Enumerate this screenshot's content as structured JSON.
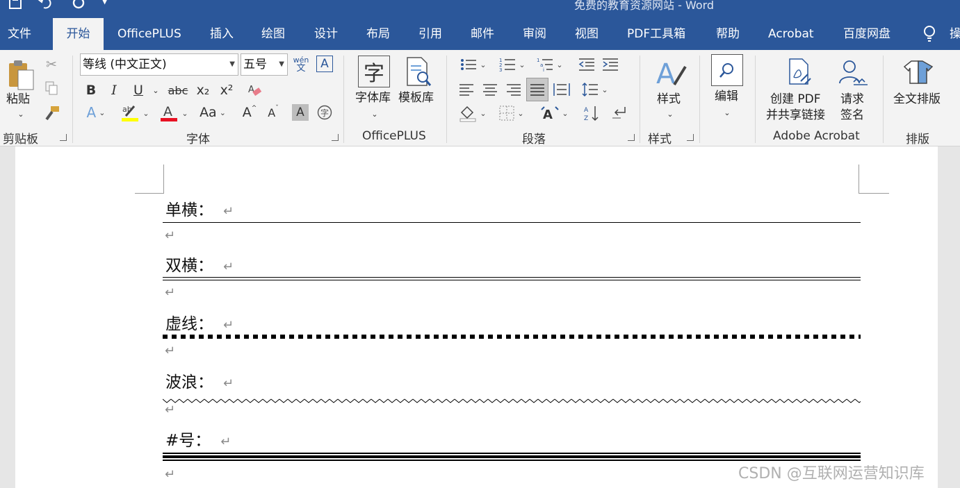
{
  "titlebar": {
    "doc_title": "免费的教育资源网站  -  Word",
    "qat": {
      "save_icon": "save-icon",
      "undo_icon": "undo-icon",
      "redo_icon": "redo-icon",
      "customize_icon": "customize-qat-icon"
    }
  },
  "tabs": [
    "文件",
    "开始",
    "OfficePLUS",
    "插入",
    "绘图",
    "设计",
    "布局",
    "引用",
    "邮件",
    "审阅",
    "视图",
    "PDF工具箱",
    "帮助",
    "Acrobat",
    "百度网盘"
  ],
  "active_tab": "开始",
  "tell_me_truncated": "操",
  "ribbon": {
    "clipboard": {
      "paste_label": "粘贴",
      "group_label": "剪贴板"
    },
    "font": {
      "font_name": "等线 (中文正文)",
      "font_size": "五号",
      "group_label": "字体",
      "bold": "B",
      "italic": "I",
      "underline": "U",
      "strike": "abc",
      "subscript": "x₂",
      "superscript": "x²",
      "change_case": "Aa",
      "phonetic_top": "wén",
      "phonetic_bottom": "文",
      "grow": "A",
      "shrink": "A"
    },
    "officeplus": {
      "font_lib_label": "字体库",
      "template_lib_label": "模板库",
      "group_label": "OfficePLUS"
    },
    "paragraph": {
      "group_label": "段落"
    },
    "styles": {
      "styles_label": "样式",
      "group_label": "样式"
    },
    "editing": {
      "edit_label": "编辑"
    },
    "acrobat": {
      "create_pdf_label_1": "创建 PDF",
      "create_pdf_label_2": "并共享链接",
      "sign_label_1": "请求",
      "sign_label_2": "签名",
      "group_label": "Adobe Acrobat"
    },
    "layout": {
      "full_layout_label": "全文排版",
      "group_label": "排版"
    },
    "colors": {
      "accent": "#2b579a",
      "highlight": "#ffff00",
      "font_color": "#e81123"
    }
  },
  "document": {
    "paragraphs": [
      {
        "label": "单横：",
        "line_style": "single"
      },
      {
        "label": "双横：",
        "line_style": "double"
      },
      {
        "label": "虚线：",
        "line_style": "dotted"
      },
      {
        "label": "波浪：",
        "line_style": "wavy"
      },
      {
        "label": "#号：",
        "line_style": "hash"
      }
    ],
    "paragraph_mark": "↵"
  },
  "watermark": "CSDN @互联网运营知识库"
}
